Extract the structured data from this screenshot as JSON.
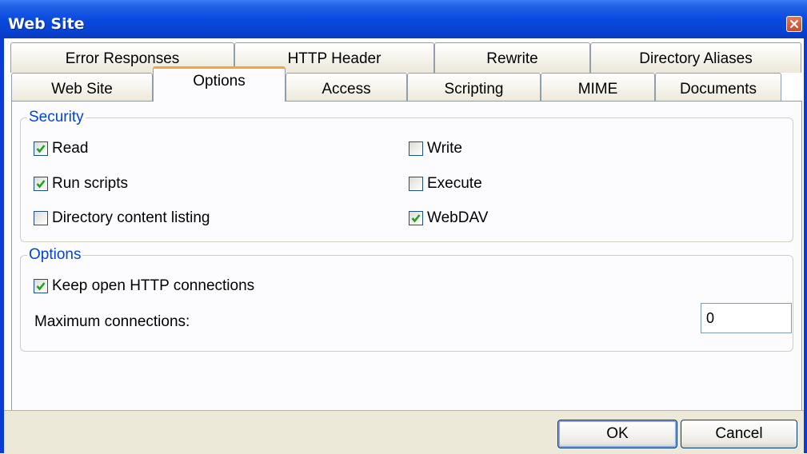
{
  "window": {
    "title": "Web Site"
  },
  "tabs": {
    "row1": [
      "Error Responses",
      "HTTP Header",
      "Rewrite",
      "Directory Aliases"
    ],
    "row2": [
      "Web Site",
      "Options",
      "Access",
      "Scripting",
      "MIME",
      "Documents"
    ],
    "active": "Options"
  },
  "security": {
    "label": "Security",
    "read": {
      "label": "Read",
      "checked": true
    },
    "write": {
      "label": "Write",
      "checked": false
    },
    "run_scripts": {
      "label": "Run scripts",
      "checked": true
    },
    "execute": {
      "label": "Execute",
      "checked": false
    },
    "directory_listing": {
      "label": "Directory content listing",
      "checked": false
    },
    "webdav": {
      "label": "WebDAV",
      "checked": true
    }
  },
  "options": {
    "label": "Options",
    "keep_open": {
      "label": "Keep open HTTP connections",
      "checked": true
    },
    "max_connections_label": "Maximum connections:",
    "max_connections_value": "0"
  },
  "buttons": {
    "ok": "OK",
    "cancel": "Cancel"
  },
  "colors": {
    "title_bar": "#0a4ae0",
    "group_label": "#0046d5",
    "active_tab_accent": "#f7a53a",
    "check": "#21a121"
  },
  "icons": {
    "close": "close-icon",
    "check": "check-icon"
  }
}
